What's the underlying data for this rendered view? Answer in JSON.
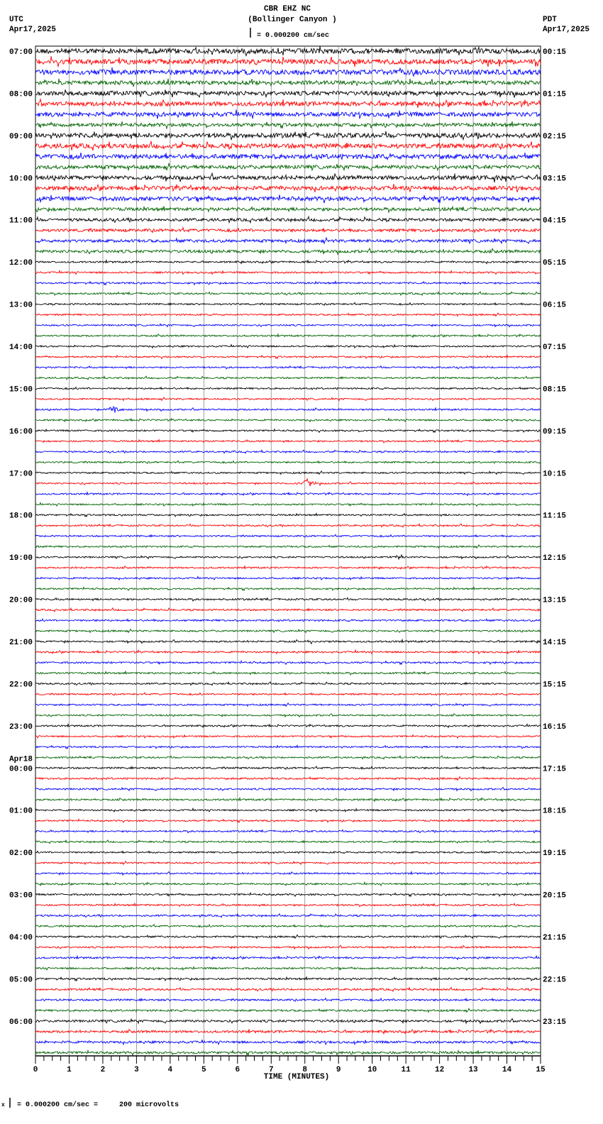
{
  "chart_data": {
    "type": "line",
    "title": "CBR EHZ NC",
    "subtitle": "(Bollinger Canyon )",
    "left_timezone": "UTC",
    "left_date": "Apr17,2025",
    "right_timezone": "PDT",
    "right_date": "Apr17,2025",
    "scale_label": "= 0.000200 cm/sec",
    "footer_label": "= 0.000200 cm/sec =     200 microvolts",
    "footer_prefix": "x",
    "xlabel": "TIME (MINUTES)",
    "xlim": [
      0,
      15
    ],
    "x_ticks": [
      "0",
      "1",
      "2",
      "3",
      "4",
      "5",
      "6",
      "7",
      "8",
      "9",
      "10",
      "11",
      "12",
      "13",
      "14",
      "15"
    ],
    "date_change_label": "Apr18",
    "utc_hours": [
      "07:00",
      "08:00",
      "09:00",
      "10:00",
      "11:00",
      "12:00",
      "13:00",
      "14:00",
      "15:00",
      "16:00",
      "17:00",
      "18:00",
      "19:00",
      "20:00",
      "21:00",
      "22:00",
      "23:00",
      "00:00",
      "01:00",
      "02:00",
      "03:00",
      "04:00",
      "05:00",
      "06:00"
    ],
    "pdt_hours": [
      "00:15",
      "01:15",
      "02:15",
      "03:15",
      "04:15",
      "05:15",
      "06:15",
      "07:15",
      "08:15",
      "09:15",
      "10:15",
      "11:15",
      "12:15",
      "13:15",
      "14:15",
      "15:15",
      "16:15",
      "17:15",
      "18:15",
      "19:15",
      "20:15",
      "21:15",
      "22:15",
      "23:15"
    ],
    "traces_per_hour": 4,
    "trace_colors": [
      "#000000",
      "#ff0000",
      "#0000ff",
      "#006400"
    ],
    "relative_noise_by_hour": [
      3.5,
      3.0,
      3.2,
      2.8,
      2.0,
      1.2,
      1.1,
      1.1,
      1.1,
      1.1,
      1.1,
      1.1,
      1.1,
      1.2,
      1.2,
      1.1,
      1.1,
      1.2,
      1.1,
      1.1,
      1.2,
      1.2,
      1.3,
      1.6
    ],
    "events": [
      {
        "hour_index": 8,
        "trace": 2,
        "minute": 2.3,
        "amplitude": 8
      },
      {
        "hour_index": 10,
        "trace": 1,
        "minute": 8.1,
        "amplitude": 9
      },
      {
        "hour_index": 3,
        "trace": 0,
        "minute": 13.9,
        "amplitude": 6
      },
      {
        "hour_index": 12,
        "trace": 0,
        "minute": 10.8,
        "amplitude": 3
      },
      {
        "hour_index": 14,
        "trace": 0,
        "minute": 8.2,
        "amplitude": 3
      }
    ]
  }
}
